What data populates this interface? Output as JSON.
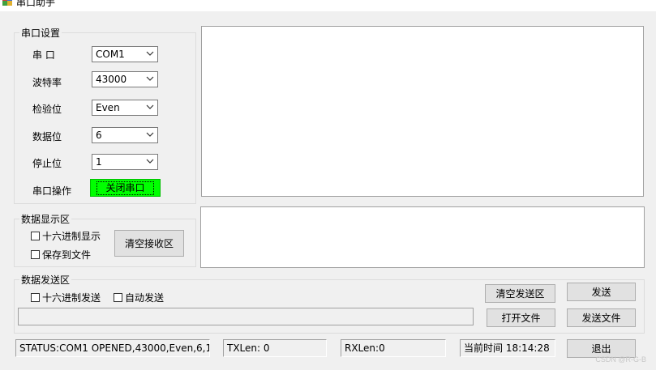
{
  "window": {
    "title": "串口助手"
  },
  "serial_settings": {
    "legend": "串口设置",
    "port_label": "串 口",
    "port_value": "COM1",
    "baud_label": "波特率",
    "baud_value": "43000",
    "parity_label": "检验位",
    "parity_value": "Even",
    "databits_label": "数据位",
    "databits_value": "6",
    "stopbits_label": "停止位",
    "stopbits_value": "1",
    "operation_label": "串口操作",
    "toggle_button": "关闭串口",
    "toggle_button_color": "#00ff00"
  },
  "display": {
    "legend": "数据显示区",
    "hex_display": "十六进制显示",
    "save_to_file": "保存到文件",
    "clear_receive": "清空接收区"
  },
  "send": {
    "legend": "数据发送区",
    "hex_send": "十六进制发送",
    "auto_send": "自动发送",
    "clear_send": "清空发送区",
    "send": "发送",
    "open_file": "打开文件",
    "send_file": "发送文件"
  },
  "status_bar": {
    "status": "STATUS:COM1 OPENED,43000,Even,6,1",
    "txlen": "TXLen:  0",
    "rxlen": "RXLen:0",
    "time": "当前时间 18:14:28",
    "exit": "退出"
  },
  "watermark": "CSDN @R-G-B",
  "icons": {
    "app": "app-icon",
    "dropdown": "chevron-down-icon"
  }
}
